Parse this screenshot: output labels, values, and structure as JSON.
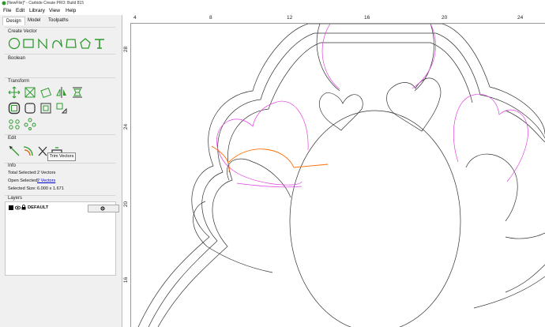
{
  "window": {
    "title": "[NewFile]* - Carbide Create PRO: Build 815"
  },
  "menu": [
    "File",
    "Edit",
    "Library",
    "View",
    "Help"
  ],
  "tabs": [
    "Design",
    "Model",
    "Toolpaths"
  ],
  "panels": {
    "create_vector": "Create Vector",
    "boolean": "Boolean",
    "transform": "Transform",
    "edit": "Edit",
    "info": "Info",
    "layers": "Layers"
  },
  "icons": {
    "create": [
      "circle-icon",
      "rectangle-icon",
      "polyline-icon",
      "curve-icon",
      "polygon-shape-icon",
      "pentagon-icon",
      "text-icon"
    ],
    "transform": [
      "move-icon",
      "resize-icon",
      "rotate-icon",
      "mirror-icon",
      "align-icon",
      "offset-icon",
      "rounded-offset-icon",
      "center-icon",
      "flip-icon",
      "array-icon",
      "circular-array-icon",
      "node-array-icon"
    ],
    "edit": [
      "node-edit-icon",
      "join-icon",
      "trim-icon",
      "trim-vectors-icon"
    ]
  },
  "tooltip": "Trim Vectors",
  "info": {
    "total_selected_label": "Total Selected:",
    "total_selected_value": "2 Vectors",
    "open_selected_label": "Open Selected:",
    "open_selected_value": "2 Vectors",
    "selected_size_label": "Selected Size:",
    "selected_size_value": "6.000 x 1.671"
  },
  "layers": [
    {
      "name": "DEFAULT",
      "color": "#000000"
    }
  ],
  "ruler": {
    "top": [
      "4",
      "8",
      "12",
      "16",
      "20",
      "24"
    ],
    "left": [
      "28",
      "24",
      "20",
      "16"
    ]
  },
  "colors": {
    "accent": "#2e9a2e",
    "selection": "#ff6a00",
    "pink": "#e040e0",
    "outline": "#333333"
  }
}
